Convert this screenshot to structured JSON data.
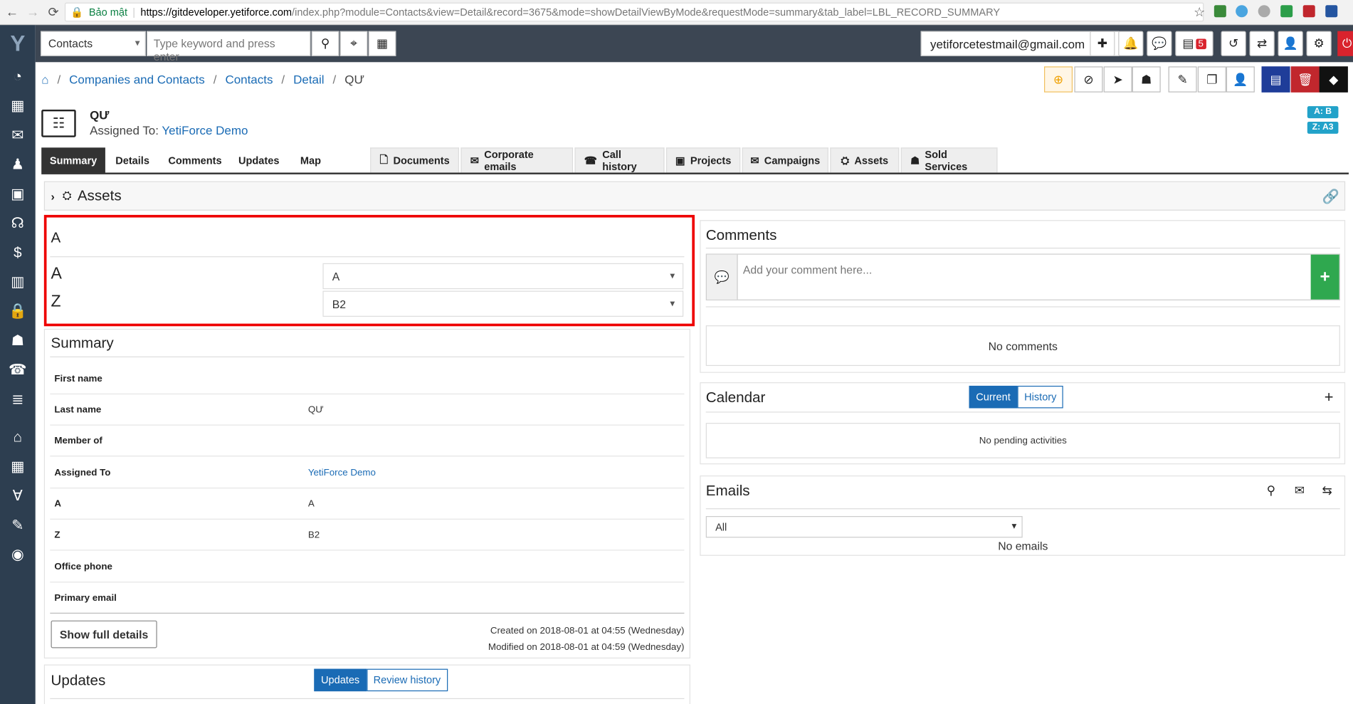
{
  "browser": {
    "secure_label": "Bảo mật",
    "url_host": "https://gitdeveloper.yetiforce.com",
    "url_rest": "/index.php?module=Contacts&view=Detail&record=3675&mode=showDetailViewByMode&requestMode=summary&tab_label=LBL_RECORD_SUMMARY"
  },
  "topbar": {
    "module_select": "Contacts",
    "search_placeholder": "Type keyword and press enter",
    "user_email": "yetiforcetestmail@gmail.com",
    "calendar_badge": "5"
  },
  "breadcrumb": {
    "items": [
      "Companies and Contacts",
      "Contacts",
      "Detail"
    ],
    "current": "QƯ"
  },
  "record": {
    "title": "QƯ",
    "assigned_label": "Assigned To:",
    "assigned_value": "YetiForce Demo",
    "badge_a": "A:  B",
    "badge_z": "Z:  A3"
  },
  "tabs": {
    "summary": "Summary",
    "details": "Details",
    "comments": "Comments",
    "updates": "Updates",
    "map": "Map",
    "related": [
      "Documents",
      "Corporate emails",
      "Call history",
      "Projects",
      "Campaigns",
      "Assets",
      "Sold Services"
    ]
  },
  "assets_bar": {
    "label": "Assets"
  },
  "custom_block": {
    "title": "A",
    "field_a_label": "A",
    "field_a_value": "A",
    "field_z_label": "Z",
    "field_z_value": "B2"
  },
  "summary": {
    "title": "Summary",
    "rows": [
      {
        "label": "First name",
        "value": ""
      },
      {
        "label": "Last name",
        "value": "QƯ"
      },
      {
        "label": "Member of",
        "value": ""
      },
      {
        "label": "Assigned To",
        "value": "YetiForce Demo"
      },
      {
        "label": "A",
        "value": "A"
      },
      {
        "label": "Z",
        "value": "B2"
      },
      {
        "label": "Office phone",
        "value": ""
      },
      {
        "label": "Primary email",
        "value": ""
      }
    ],
    "show_full": "Show full details",
    "created": "Created on 2018-08-01 at 04:55 (Wednesday)",
    "modified": "Modified on 2018-08-01 at 04:59 (Wednesday)"
  },
  "updates": {
    "title": "Updates",
    "btn_updates": "Updates",
    "btn_review": "Review history"
  },
  "comments": {
    "title": "Comments",
    "placeholder": "Add your comment here...",
    "empty": "No comments"
  },
  "calendar": {
    "title": "Calendar",
    "btn_current": "Current",
    "btn_history": "History",
    "empty": "No pending activities"
  },
  "emails": {
    "title": "Emails",
    "select": "All",
    "empty": "No emails"
  }
}
